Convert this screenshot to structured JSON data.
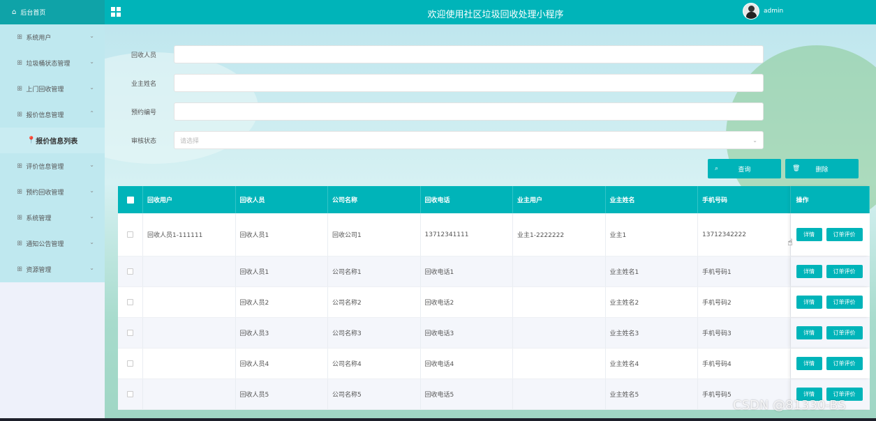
{
  "header": {
    "home_label": "后台首页",
    "title": "欢迎使用社区垃圾回收处理小程序",
    "username": "admin"
  },
  "sidebar": {
    "items": [
      {
        "label": "系统用户",
        "chev": "⌄"
      },
      {
        "label": "垃圾桶状态管理",
        "chev": "⌄"
      },
      {
        "label": "上门回收管理",
        "chev": "⌄"
      },
      {
        "label": "报价信息管理",
        "chev": "⌃"
      },
      {
        "label": "评价信息管理",
        "chev": "⌄"
      },
      {
        "label": "预约回收管理",
        "chev": "⌄"
      },
      {
        "label": "系统管理",
        "chev": "⌄"
      },
      {
        "label": "通知公告管理",
        "chev": "⌄"
      },
      {
        "label": "资源管理",
        "chev": "⌄"
      }
    ],
    "submenu_active": "报价信息列表"
  },
  "search": {
    "fields": [
      {
        "label": "回收人员",
        "value": ""
      },
      {
        "label": "业主姓名",
        "value": ""
      },
      {
        "label": "预约编号",
        "value": ""
      },
      {
        "label": "审核状态",
        "placeholder": "请选择"
      }
    ],
    "query_label": "查询",
    "delete_label": "删除"
  },
  "table": {
    "columns": [
      "回收用户",
      "回收人员",
      "公司名称",
      "回收电话",
      "业主用户",
      "业主姓名",
      "手机号码",
      "操作"
    ],
    "rows": [
      [
        "回收人员1-111111",
        "回收人员1",
        "回收公司1",
        "13712341111",
        "业主1-2222222",
        "业主1",
        "13712342222"
      ],
      [
        "",
        "回收人员1",
        "公司名称1",
        "回收电话1",
        "",
        "业主姓名1",
        "手机号码1"
      ],
      [
        "",
        "回收人员2",
        "公司名称2",
        "回收电话2",
        "",
        "业主姓名2",
        "手机号码2"
      ],
      [
        "",
        "回收人员3",
        "公司名称3",
        "回收电话3",
        "",
        "业主姓名3",
        "手机号码3"
      ],
      [
        "",
        "回收人员4",
        "公司名称4",
        "回收电话4",
        "",
        "业主姓名4",
        "手机号码4"
      ],
      [
        "",
        "回收人员5",
        "公司名称5",
        "回收电话5",
        "",
        "业主姓名5",
        "手机号码5"
      ]
    ],
    "action_detail": "详情",
    "action_review": "订单评价"
  },
  "watermark": "CSDN @81330-BS",
  "colors": {
    "accent": "#00b4b9",
    "sidebar_bg": "#bfe8ef"
  }
}
